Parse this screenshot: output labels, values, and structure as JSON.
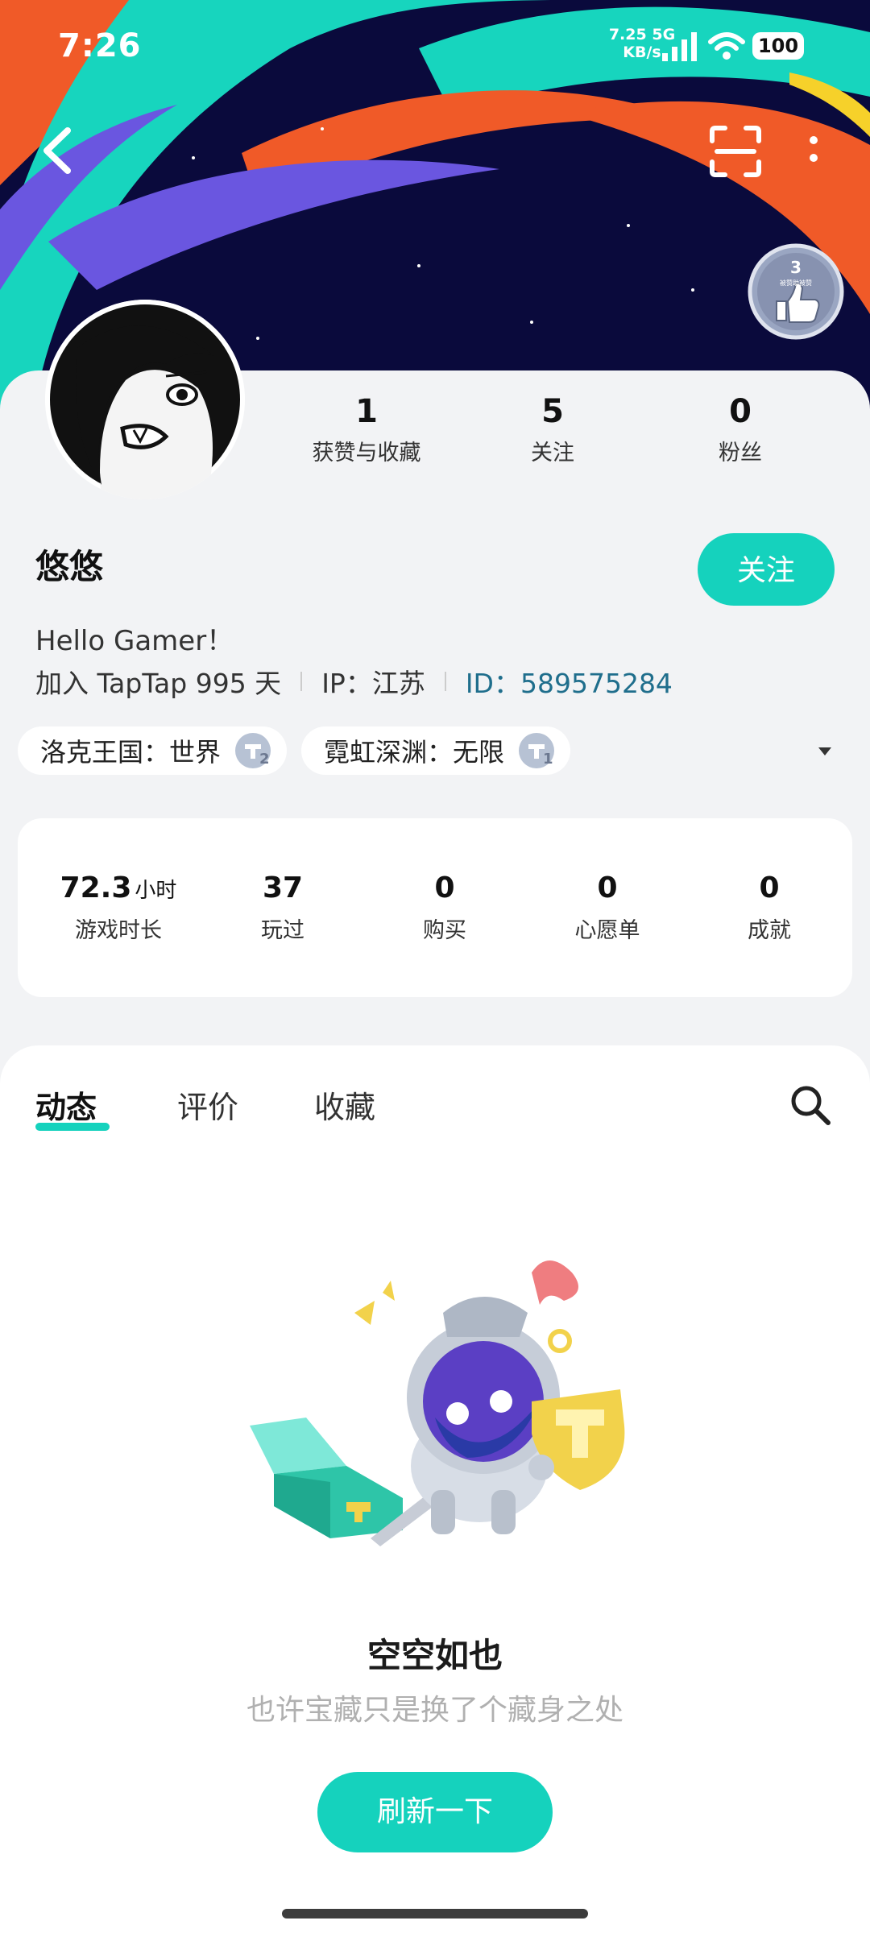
{
  "status_bar": {
    "time": "7:26",
    "net_speed_value": "7.25",
    "net_speed_unit": "KB/s",
    "net_type": "5G",
    "battery": "100"
  },
  "badge": {
    "level": "3",
    "caption": "被赞助被赞"
  },
  "profile": {
    "stats": [
      {
        "value": "1",
        "label": "获赞与收藏"
      },
      {
        "value": "5",
        "label": "关注"
      },
      {
        "value": "0",
        "label": "粉丝"
      }
    ],
    "username": "悠悠",
    "follow_label": "关注",
    "bio": "Hello Gamer！",
    "joined": "加入 TapTap 995 天",
    "ip": "IP：江苏",
    "id": "ID：589575284",
    "game_tags": [
      {
        "text": "洛克王国：世界",
        "level": "2"
      },
      {
        "text": "霓虹深渊：无限",
        "level": "1"
      }
    ]
  },
  "game_stats": [
    {
      "value": "72.3",
      "unit": "小时",
      "label": "游戏时长"
    },
    {
      "value": "37",
      "unit": "",
      "label": "玩过"
    },
    {
      "value": "0",
      "unit": "",
      "label": "购买"
    },
    {
      "value": "0",
      "unit": "",
      "label": "心愿单"
    },
    {
      "value": "0",
      "unit": "",
      "label": "成就"
    }
  ],
  "tabs": [
    {
      "label": "动态",
      "active": true
    },
    {
      "label": "评价",
      "active": false
    },
    {
      "label": "收藏",
      "active": false
    }
  ],
  "empty_state": {
    "title": "空空如也",
    "subtitle": "也许宝藏只是换了个藏身之处",
    "button": "刷新一下"
  },
  "colors": {
    "accent": "#15d2bd",
    "banner_bg": "#0a0a3c",
    "id_color": "#1f6e8c"
  }
}
